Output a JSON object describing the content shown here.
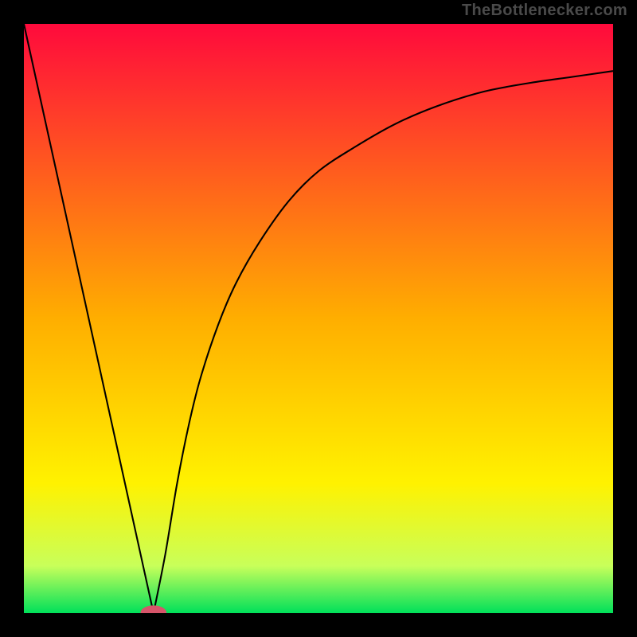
{
  "attribution": "TheBottlenecker.com",
  "chart_data": {
    "type": "line",
    "title": "",
    "xlabel": "",
    "ylabel": "",
    "xlim": [
      0,
      100
    ],
    "ylim": [
      0,
      100
    ],
    "gradient_stops": [
      {
        "offset": 0,
        "color": "#ff0a3c"
      },
      {
        "offset": 50,
        "color": "#ffae00"
      },
      {
        "offset": 78,
        "color": "#fff200"
      },
      {
        "offset": 92,
        "color": "#c8ff5a"
      },
      {
        "offset": 100,
        "color": "#00e05a"
      }
    ],
    "curve": {
      "min_x": 22,
      "left_branch": [
        {
          "x": 0,
          "y": 100
        },
        {
          "x": 22,
          "y": 0
        }
      ],
      "right_branch": [
        {
          "x": 22,
          "y": 0
        },
        {
          "x": 24,
          "y": 10
        },
        {
          "x": 26,
          "y": 22
        },
        {
          "x": 28,
          "y": 32
        },
        {
          "x": 30,
          "y": 40
        },
        {
          "x": 33,
          "y": 49
        },
        {
          "x": 36,
          "y": 56
        },
        {
          "x": 40,
          "y": 63
        },
        {
          "x": 45,
          "y": 70
        },
        {
          "x": 50,
          "y": 75
        },
        {
          "x": 56,
          "y": 79
        },
        {
          "x": 63,
          "y": 83
        },
        {
          "x": 70,
          "y": 86
        },
        {
          "x": 78,
          "y": 88.5
        },
        {
          "x": 86,
          "y": 90
        },
        {
          "x": 93,
          "y": 91
        },
        {
          "x": 100,
          "y": 92
        }
      ]
    },
    "marker": {
      "cx": 22,
      "cy": 0,
      "rx": 2.2,
      "ry": 1.2,
      "color": "#d6556a"
    }
  }
}
